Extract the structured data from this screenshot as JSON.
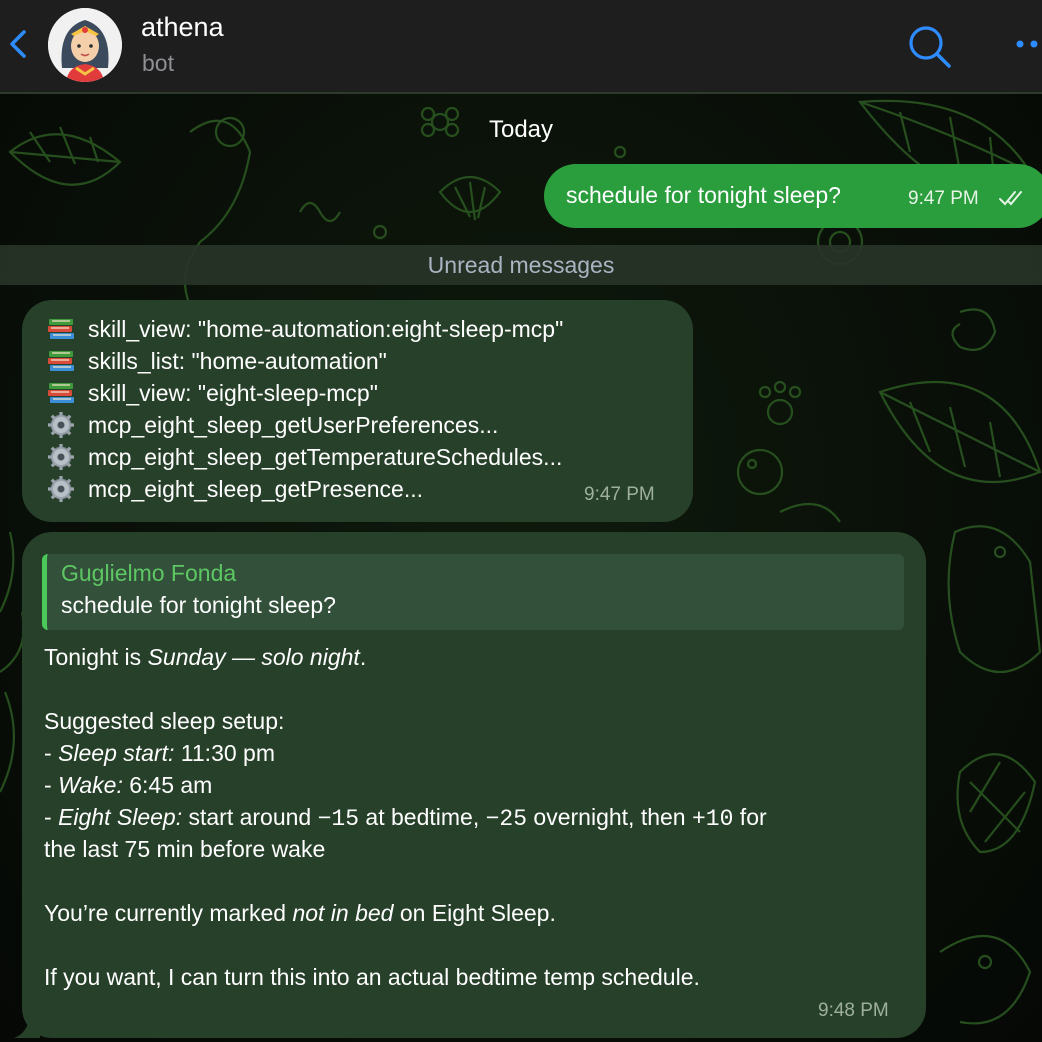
{
  "header": {
    "name": "athena",
    "subtitle": "bot"
  },
  "date_label": "Today",
  "outgoing": {
    "text": "schedule for tonight sleep?",
    "time": "9:47 PM",
    "status_icon": "double-check-icon"
  },
  "unread_label": "Unread messages",
  "tool_message": {
    "lines": [
      {
        "icon": "books-icon",
        "text": "skill_view: \"home-automation:eight-sleep-mcp\""
      },
      {
        "icon": "books-icon",
        "text": "skills_list: \"home-automation\""
      },
      {
        "icon": "books-icon",
        "text": "skill_view: \"eight-sleep-mcp\""
      },
      {
        "icon": "gear-icon",
        "text": "mcp_eight_sleep_getUserPreferences..."
      },
      {
        "icon": "gear-icon",
        "text": "mcp_eight_sleep_getTemperatureSchedules..."
      },
      {
        "icon": "gear-icon",
        "text": "mcp_eight_sleep_getPresence..."
      }
    ],
    "time": "9:47 PM"
  },
  "reply_message": {
    "quote_author": "Guglielmo Fonda",
    "quote_text": "schedule for tonight sleep?",
    "line1_a": "Tonight is ",
    "line1_b": "Sunday — solo night",
    "line1_c": ".",
    "line2": "Suggested sleep setup:",
    "line3_a": "- ",
    "line3_b": "Sleep start:",
    "line3_c": " 11:30 pm",
    "line4_a": "- ",
    "line4_b": "Wake:",
    "line4_c": " 6:45 am",
    "line5_a": "- ",
    "line5_b": "Eight Sleep:",
    "line5_c": " start around ",
    "line5_d": "−15",
    "line5_e": " at bedtime, ",
    "line5_f": "−25",
    "line5_g": " overnight, then ",
    "line5_h": "+10",
    "line5_i": " for",
    "line6": "the last 75 min before wake",
    "line7_a": "You’re currently marked ",
    "line7_b": "not in bed",
    "line7_c": " on Eight Sleep.",
    "line8": "If you want, I can turn this into an actual bedtime temp schedule.",
    "time": "9:48 PM"
  },
  "colors": {
    "header_bg": "#1e1e1f",
    "accent_blue": "#2f8cff",
    "outgoing_bubble": "#2a9d3d",
    "incoming_bubble": "#27402a",
    "quote_accent": "#4cc759"
  }
}
